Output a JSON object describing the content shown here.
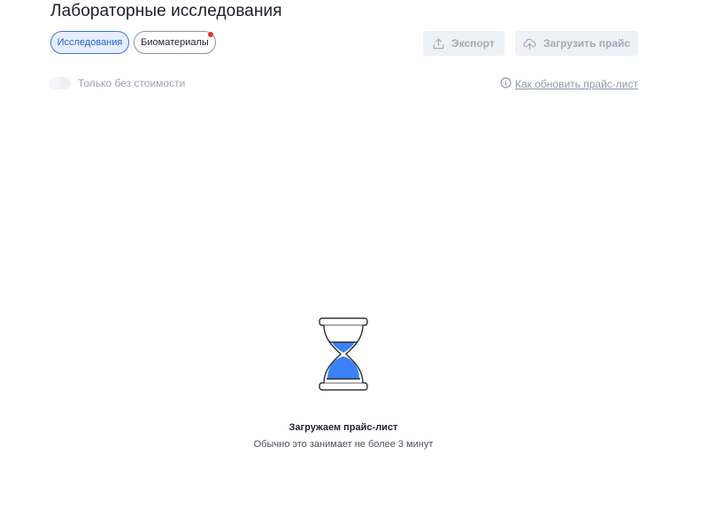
{
  "header": {
    "title": "Лабораторные исследования"
  },
  "tabs": [
    {
      "label": "Исследования",
      "active": true
    },
    {
      "label": "Биоматериалы",
      "active": false,
      "has_notification": true
    }
  ],
  "toolbar": {
    "export_label": "Экспорт",
    "upload_label": "Загрузить прайс"
  },
  "filter": {
    "no_cost_label": "Только без стоимости",
    "no_cost_enabled": false
  },
  "help": {
    "link_label": "Как обновить прайс-лист"
  },
  "loading": {
    "title": "Загружаем прайс-лист",
    "subtitle": "Обычно это занимает не более 3 минут"
  },
  "colors": {
    "accent": "#3f73d6",
    "sand": "#3b82f6",
    "notification": "#e5322d",
    "disabled_text": "#a2aab7"
  },
  "icons": {
    "export": "upload-icon",
    "upload": "cloud-upload-icon",
    "help": "info-icon",
    "loader": "hourglass-icon"
  }
}
